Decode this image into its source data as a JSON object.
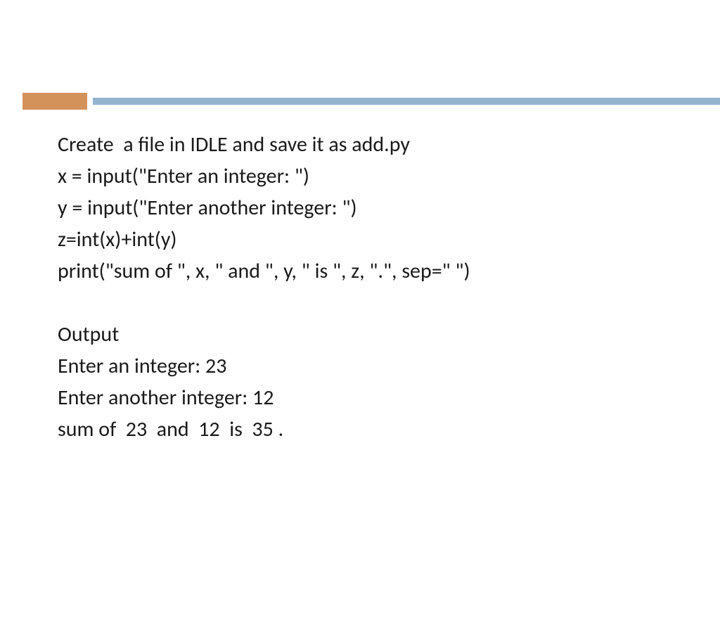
{
  "lines": {
    "l1": "Create  a file in IDLE and save it as add.py",
    "l2": "x = input(\"Enter an integer: \")",
    "l3": "y = input(\"Enter another integer: \")",
    "l4": "z=int(x)+int(y)",
    "l5": "print(\"sum of \", x, \" and \", y, \" is \", z, \".\", sep=\" \")",
    "l6": "Output",
    "l7": "Enter an integer: 23",
    "l8": "Enter another integer: 12",
    "l9": "sum of  23  and  12  is  35 ."
  },
  "colors": {
    "accent_orange": "#d4925b",
    "accent_blue": "#94b3cf"
  }
}
